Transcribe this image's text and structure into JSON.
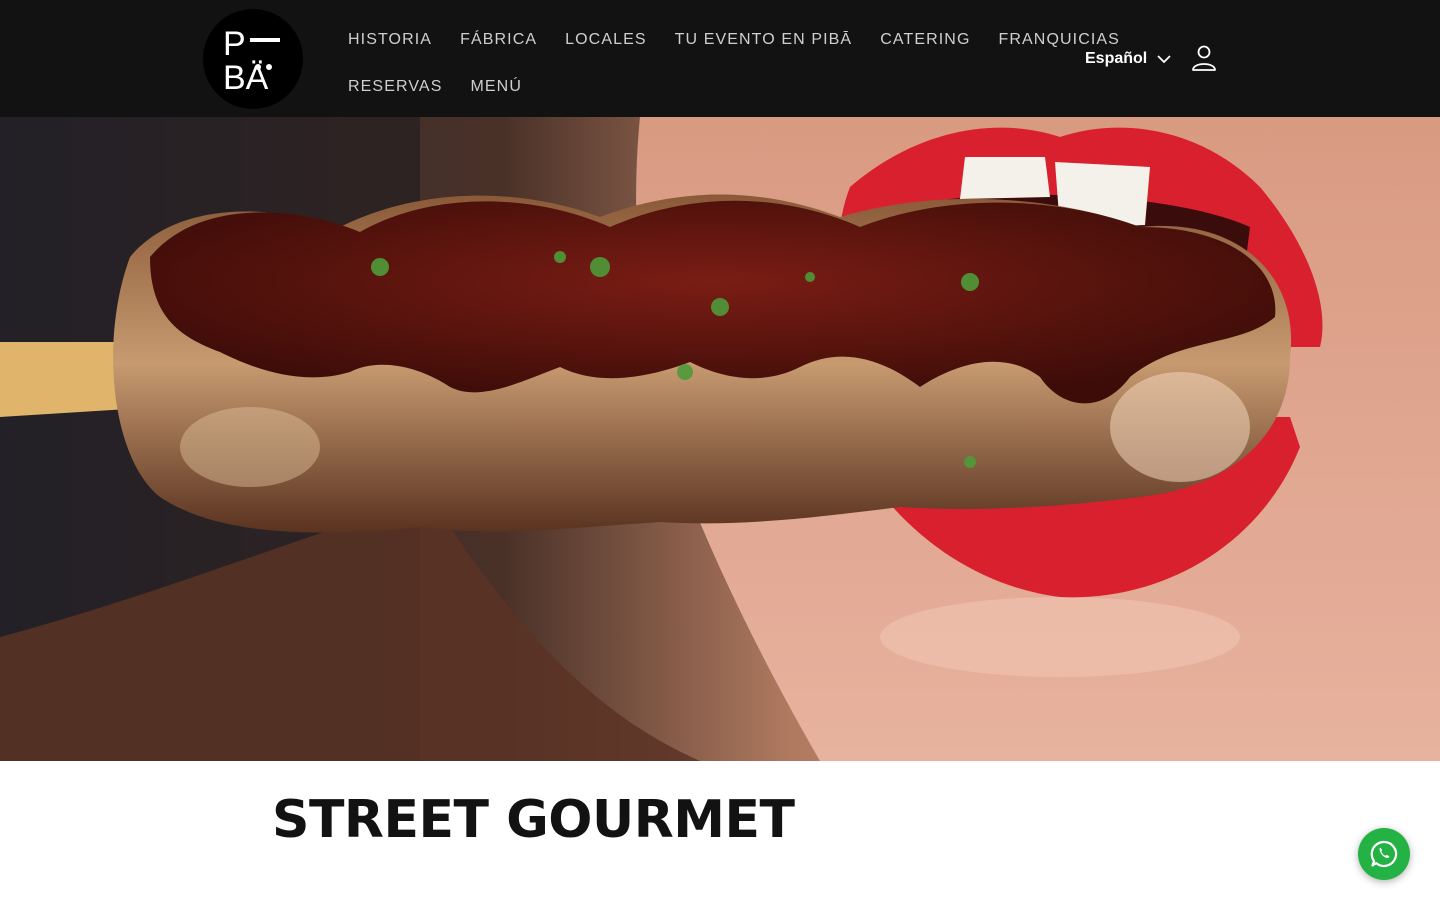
{
  "brand": {
    "logo_line1": "P",
    "logo_line2": "BÄ",
    "accent": "#121212",
    "lip_red": "#d9202f"
  },
  "nav": {
    "row1": [
      "HISTORIA",
      "FÁBRICA",
      "LOCALES",
      "TU EVENTO EN PIBĀ",
      "CATERING",
      "FRANQUICIAS"
    ],
    "row2": [
      "RESERVAS",
      "MENÚ"
    ]
  },
  "language": {
    "selected": "Español",
    "icon": "chevron-down-icon"
  },
  "account": {
    "icon": "user-icon"
  },
  "hero": {
    "image": "skewer-with-bbq-sauce-bitten-by-red-lips"
  },
  "page": {
    "title": "STREET GOURMET"
  },
  "chat": {
    "icon": "whatsapp-icon",
    "color": "#25b244"
  }
}
